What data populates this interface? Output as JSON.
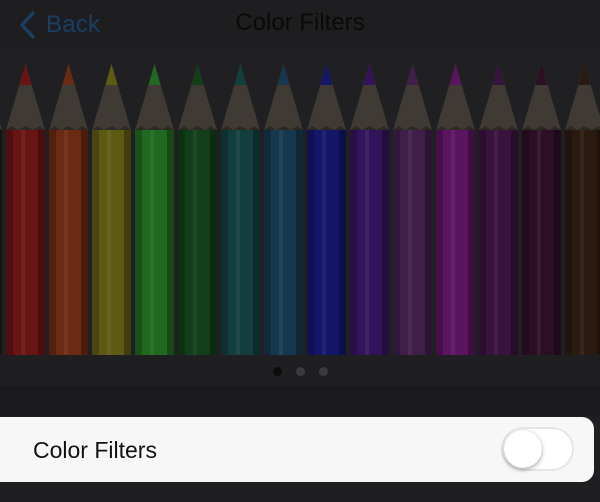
{
  "nav": {
    "back_label": "Back",
    "back_icon": "chevron-left-icon",
    "title": "Color Filters"
  },
  "carousel": {
    "pencil_colors": [
      "#6a1414",
      "#6b2a12",
      "#5e5a14",
      "#1f6a1f",
      "#123f1a",
      "#123e3e",
      "#16384e",
      "#14166a",
      "#33145c",
      "#3f1e4a",
      "#5a1460",
      "#3a123e",
      "#2c0f24",
      "#2a1a10"
    ],
    "page_count": 3,
    "active_page": 1
  },
  "setting": {
    "label": "Color Filters",
    "enabled": false
  },
  "colors": {
    "accent": "#1a3f63",
    "row_background": "#f7f7f8",
    "dimmed_background": "#1f1f21"
  }
}
